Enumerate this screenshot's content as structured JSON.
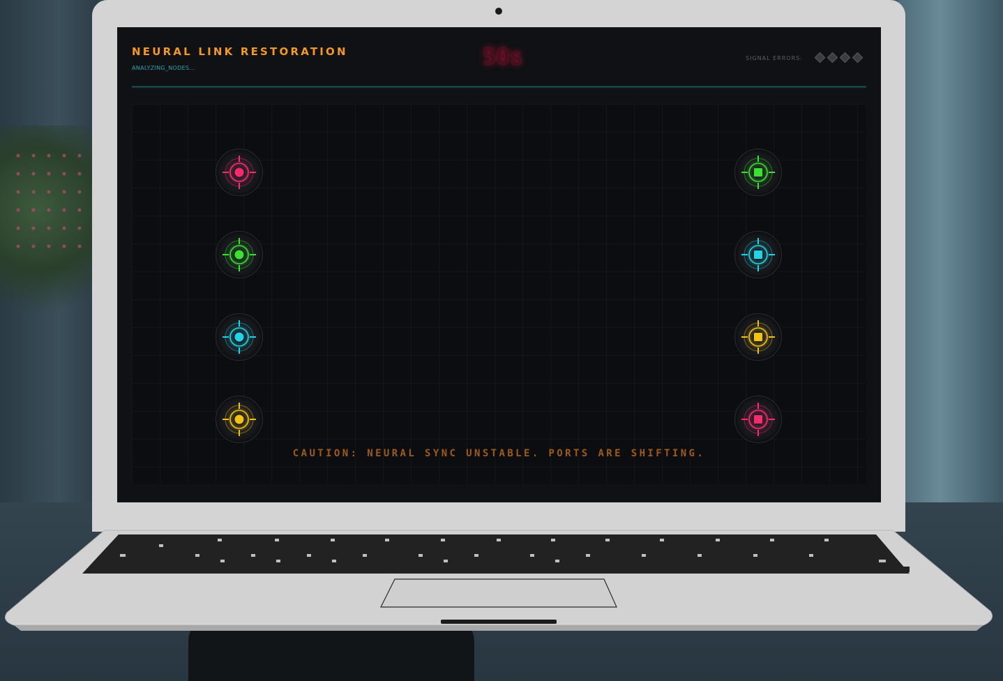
{
  "game": {
    "title": "NEURAL LINK RESTORATION",
    "subtitle": "ANALYZING_NODES...",
    "timer": "50s",
    "signal_errors_label": "SIGNAL ERRORS:",
    "signal_errors_total": 4,
    "signal_errors_used": 0,
    "caution": "CAUTION: NEURAL SYNC UNSTABLE. PORTS ARE SHIFTING."
  },
  "ports": {
    "left": [
      {
        "color": "#ff2a6d",
        "shape": "circle"
      },
      {
        "color": "#39e22c",
        "shape": "circle"
      },
      {
        "color": "#1ed4e6",
        "shape": "circle"
      },
      {
        "color": "#f4c20d",
        "shape": "circle"
      }
    ],
    "right": [
      {
        "color": "#39e22c",
        "shape": "square"
      },
      {
        "color": "#1ed4e6",
        "shape": "square"
      },
      {
        "color": "#f4c20d",
        "shape": "square"
      },
      {
        "color": "#ff2a6d",
        "shape": "square"
      }
    ]
  },
  "colors": {
    "accent_orange": "#f39a1e",
    "accent_cyan": "#1ea7b0",
    "timer_red": "#4a0d1d",
    "screen_bg": "#101114"
  }
}
